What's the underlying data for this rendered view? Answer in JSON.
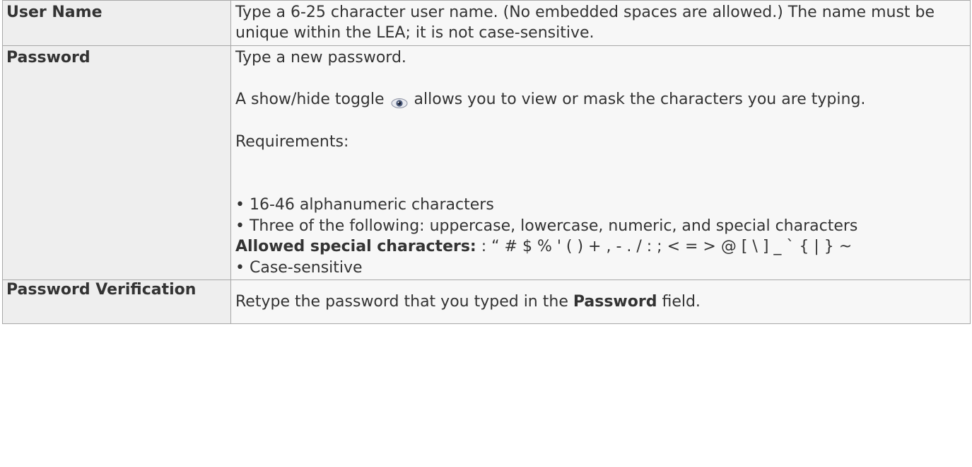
{
  "rows": [
    {
      "label": "User Name",
      "lines": [
        "Type a 6-25 character user name. (No embedded spaces are allowed.) The name must be unique within the LEA; it is not case-sensitive."
      ]
    },
    {
      "label": "Password",
      "intro": "Type a new password.",
      "toggle_before": "A show/hide toggle",
      "toggle_icon": "eye-icon",
      "toggle_after": "allows you to view or mask the characters you are typing.",
      "requirements_heading": "Requirements:",
      "req_1": "• 16-46 alphanumeric characters",
      "req_2": " • Three of the following: uppercase, lowercase, numeric, and special characters",
      "special_label": "Allowed special characters:",
      "special_chars": " : “ # $ % ' ( ) + , - . / : ; < = > @ [ \\ ] _ ` { | } ~",
      "req_4": " • Case-sensitive"
    },
    {
      "label": "Password Verification",
      "before": "Retype the password that you typed in the ",
      "bold": "Password",
      "after": " field."
    }
  ],
  "colors": {
    "label_bg": "#eeeeee",
    "desc_bg": "#f7f7f7",
    "border": "#a8a8a8",
    "text": "#333333"
  }
}
